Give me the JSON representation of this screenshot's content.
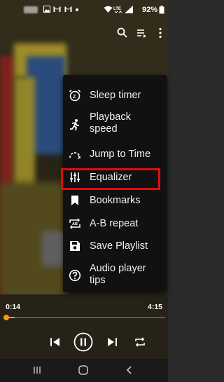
{
  "status_bar": {
    "battery_percent": "92%",
    "icons": [
      "gallery-icon",
      "gmail-icon",
      "mail-icon",
      "dot-icon",
      "wifi-icon",
      "lte-icon",
      "signal-icon",
      "battery-icon"
    ]
  },
  "toolbar": {
    "icons": [
      "search-icon",
      "playlist-icon",
      "more-vert-icon"
    ]
  },
  "menu": {
    "items": [
      {
        "label": "Sleep timer",
        "icon": "sleep-timer-icon"
      },
      {
        "label": "Playback speed",
        "icon": "running-figure-icon"
      },
      {
        "label": "Jump to Time",
        "icon": "jump-arc-icon"
      },
      {
        "label": "Equalizer",
        "icon": "equalizer-icon"
      },
      {
        "label": "Bookmarks",
        "icon": "bookmark-icon",
        "highlighted": true
      },
      {
        "label": "A-B repeat",
        "icon": "ab-repeat-icon"
      },
      {
        "label": "Save Playlist",
        "icon": "save-icon"
      },
      {
        "label": "Audio player tips",
        "icon": "help-icon"
      }
    ],
    "highlight_color": "#e20c0c"
  },
  "player": {
    "elapsed": "0:14",
    "duration": "4:15",
    "progress_percent": 5.5,
    "accent": "#f39c1a",
    "controls": [
      "previous-icon",
      "pause-icon",
      "next-icon",
      "repeat-icon"
    ]
  },
  "nav_bar": {
    "icons": [
      "recents-icon",
      "home-icon",
      "back-icon"
    ]
  }
}
